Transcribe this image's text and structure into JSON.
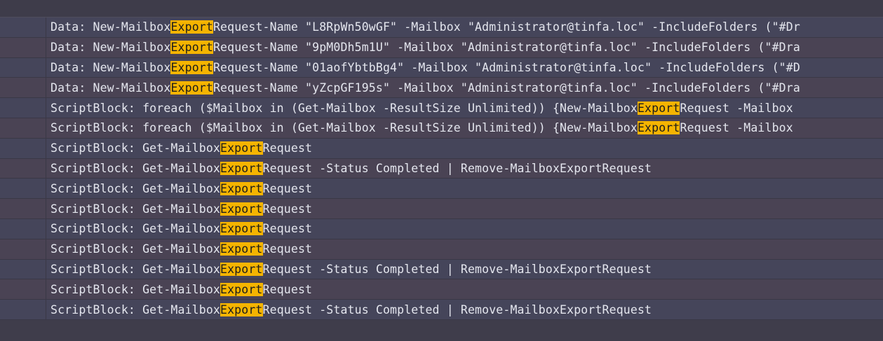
{
  "search": {
    "highlight_term": "Export",
    "highlight_color": "#f5b400"
  },
  "rows": [
    {
      "pre": "Data: New-Mailbox",
      "hl": "Export",
      "post": "Request-Name \"L8RpWn50wGF\" -Mailbox \"Administrator@tinfa.loc\" -IncludeFolders (\"#Dr"
    },
    {
      "pre": "Data: New-Mailbox",
      "hl": "Export",
      "post": "Request-Name \"9pM0Dh5m1U\" -Mailbox \"Administrator@tinfa.loc\" -IncludeFolders (\"#Dra"
    },
    {
      "pre": "Data: New-Mailbox",
      "hl": "Export",
      "post": "Request-Name \"01aofYbtbBg4\" -Mailbox \"Administrator@tinfa.loc\" -IncludeFolders (\"#D"
    },
    {
      "pre": "Data: New-Mailbox",
      "hl": "Export",
      "post": "Request-Name \"yZcpGF195s\" -Mailbox \"Administrator@tinfa.loc\" -IncludeFolders (\"#Dra"
    },
    {
      "pre": "ScriptBlock: foreach ($Mailbox in (Get-Mailbox -ResultSize Unlimited)) {New-Mailbox",
      "hl": "Export",
      "post": "Request -Mailbox"
    },
    {
      "pre": "ScriptBlock: foreach ($Mailbox in (Get-Mailbox -ResultSize Unlimited)) {New-Mailbox",
      "hl": "Export",
      "post": "Request -Mailbox"
    },
    {
      "pre": "ScriptBlock: Get-Mailbox",
      "hl": "Export",
      "post": "Request"
    },
    {
      "pre": "ScriptBlock: Get-Mailbox",
      "hl": "Export",
      "post": "Request -Status Completed | Remove-MailboxExportRequest"
    },
    {
      "pre": "ScriptBlock: Get-Mailbox",
      "hl": "Export",
      "post": "Request"
    },
    {
      "pre": "ScriptBlock: Get-Mailbox",
      "hl": "Export",
      "post": "Request"
    },
    {
      "pre": "ScriptBlock: Get-Mailbox",
      "hl": "Export",
      "post": "Request"
    },
    {
      "pre": "ScriptBlock: Get-Mailbox",
      "hl": "Export",
      "post": "Request"
    },
    {
      "pre": "ScriptBlock: Get-Mailbox",
      "hl": "Export",
      "post": "Request -Status Completed | Remove-MailboxExportRequest"
    },
    {
      "pre": "ScriptBlock: Get-Mailbox",
      "hl": "Export",
      "post": "Request"
    },
    {
      "pre": "ScriptBlock: Get-Mailbox",
      "hl": "Export",
      "post": "Request -Status Completed | Remove-MailboxExportRequest"
    }
  ]
}
